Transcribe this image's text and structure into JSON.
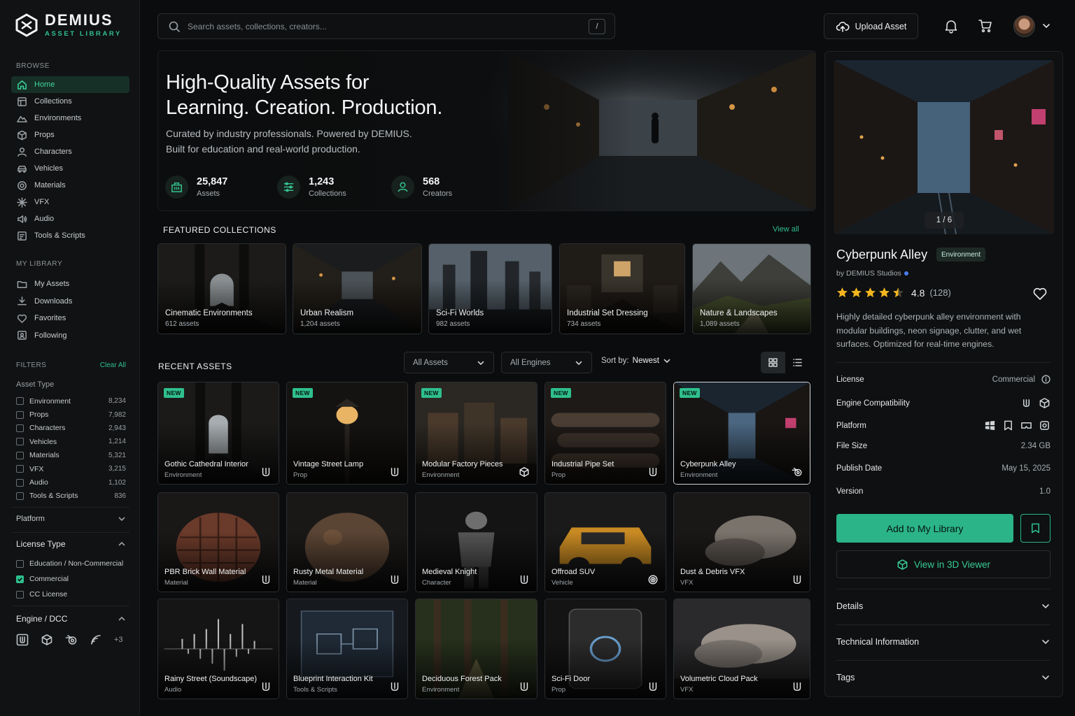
{
  "brand": {
    "name": "DEMIUS",
    "subtitle": "ASSET LIBRARY"
  },
  "sidebar": {
    "browse_heading": "BROWSE",
    "browse": [
      {
        "label": "Home",
        "icon": "home-icon",
        "active": true
      },
      {
        "label": "Collections",
        "icon": "collections-icon"
      },
      {
        "label": "Environments",
        "icon": "mountain-icon"
      },
      {
        "label": "Props",
        "icon": "cube-icon"
      },
      {
        "label": "Characters",
        "icon": "user-icon"
      },
      {
        "label": "Vehicles",
        "icon": "car-icon"
      },
      {
        "label": "Materials",
        "icon": "material-icon"
      },
      {
        "label": "VFX",
        "icon": "sparkle-icon"
      },
      {
        "label": "Audio",
        "icon": "audio-icon"
      },
      {
        "label": "Tools & Scripts",
        "icon": "tools-icon"
      }
    ],
    "library_heading": "MY LIBRARY",
    "library": [
      {
        "label": "My Assets",
        "icon": "folder-icon"
      },
      {
        "label": "Downloads",
        "icon": "download-icon"
      },
      {
        "label": "Favorites",
        "icon": "heart-icon"
      },
      {
        "label": "Following",
        "icon": "following-icon"
      }
    ],
    "filters_heading": "FILTERS",
    "clear_all": "Clear All",
    "asset_type_heading": "Asset Type",
    "asset_types": [
      {
        "label": "Environment",
        "count": "8,234"
      },
      {
        "label": "Props",
        "count": "7,982"
      },
      {
        "label": "Characters",
        "count": "2,943"
      },
      {
        "label": "Vehicles",
        "count": "1,214"
      },
      {
        "label": "Materials",
        "count": "5,321"
      },
      {
        "label": "VFX",
        "count": "3,215"
      },
      {
        "label": "Audio",
        "count": "1,102"
      },
      {
        "label": "Tools & Scripts",
        "count": "836"
      }
    ],
    "platform_heading": "Platform",
    "license_heading": "License Type",
    "licenses": [
      {
        "label": "Education / Non-Commercial",
        "checked": false
      },
      {
        "label": "Commercial",
        "checked": true
      },
      {
        "label": "CC License",
        "checked": false
      }
    ],
    "engine_heading": "Engine / DCC",
    "engine_more": "+3"
  },
  "topbar": {
    "search_placeholder": "Search assets, collections, creators...",
    "search_shortcut": "/",
    "upload_label": "Upload Asset"
  },
  "hero": {
    "title_line1": "High-Quality Assets for",
    "title_line2": "Learning. Creation. Production.",
    "subtitle_line1": "Curated by industry professionals. Powered by DEMIUS.",
    "subtitle_line2": "Built for education and real-world production.",
    "stats": [
      {
        "value": "25,847",
        "label": "Assets"
      },
      {
        "value": "1,243",
        "label": "Collections"
      },
      {
        "value": "568",
        "label": "Creators"
      }
    ]
  },
  "featured": {
    "heading": "FEATURED COLLECTIONS",
    "view_all": "View all",
    "items": [
      {
        "title": "Cinematic Environments",
        "count": "612 assets"
      },
      {
        "title": "Urban Realism",
        "count": "1,204 assets"
      },
      {
        "title": "Sci-Fi Worlds",
        "count": "982 assets"
      },
      {
        "title": "Industrial Set Dressing",
        "count": "734 assets"
      },
      {
        "title": "Nature & Landscapes",
        "count": "1,089 assets"
      }
    ]
  },
  "recent": {
    "heading": "RECENT ASSETS",
    "filter_assets": "All Assets",
    "filter_engines": "All Engines",
    "sort_label": "Sort by:",
    "sort_value": "Newest",
    "new_badge": "NEW",
    "items": [
      {
        "title": "Gothic Cathedral Interior",
        "type": "Environment",
        "new": true,
        "engine": "unreal-icon"
      },
      {
        "title": "Vintage Street Lamp",
        "type": "Prop",
        "new": true,
        "engine": "unreal-icon"
      },
      {
        "title": "Modular Factory Pieces",
        "type": "Environment",
        "new": true,
        "engine": "unity-icon"
      },
      {
        "title": "Industrial Pipe Set",
        "type": "Prop",
        "new": true,
        "engine": "unreal-icon"
      },
      {
        "title": "Cyberpunk Alley",
        "type": "Environment",
        "new": true,
        "engine": "blender-icon"
      },
      {
        "title": "PBR Brick Wall Material",
        "type": "Material",
        "engine": "unreal-icon"
      },
      {
        "title": "Rusty Metal Material",
        "type": "Material",
        "engine": "unreal-icon"
      },
      {
        "title": "Medieval Knight",
        "type": "Character",
        "engine": "unreal-icon"
      },
      {
        "title": "Offroad SUV",
        "type": "Vehicle",
        "engine": "houdini-icon"
      },
      {
        "title": "Dust & Debris VFX",
        "type": "VFX",
        "engine": "unreal-icon"
      },
      {
        "title": "Rainy Street (Soundscape)",
        "type": "Audio",
        "engine": "unreal-icon"
      },
      {
        "title": "Blueprint Interaction Kit",
        "type": "Tools & Scripts",
        "engine": "unreal-icon"
      },
      {
        "title": "Deciduous Forest Pack",
        "type": "Environment",
        "engine": "unreal-icon"
      },
      {
        "title": "Sci-Fi Door",
        "type": "Prop",
        "engine": "unreal-icon"
      },
      {
        "title": "Volumetric Cloud Pack",
        "type": "VFX",
        "engine": "unreal-icon"
      }
    ]
  },
  "detail": {
    "pager": "1 / 6",
    "title": "Cyberpunk Alley",
    "tag": "Environment",
    "by": "by DEMIUS Studios",
    "rating_value": "4.8",
    "rating_count": "(128)",
    "rating_stars": 4.5,
    "description": "Highly detailed cyberpunk alley environment with modular buildings, neon signage, clutter, and wet surfaces. Optimized for real-time engines.",
    "rows": [
      {
        "label": "License",
        "value": "Commercial"
      },
      {
        "label": "Engine Compatibility",
        "value": ""
      },
      {
        "label": "Platform",
        "value": ""
      },
      {
        "label": "File Size",
        "value": "2.34 GB"
      },
      {
        "label": "Publish Date",
        "value": "May 15, 2025"
      },
      {
        "label": "Version",
        "value": "1.0"
      }
    ],
    "add_label": "Add to My Library",
    "view3d_label": "View in 3D Viewer",
    "accordions": [
      "Details",
      "Technical Information",
      "Tags"
    ]
  },
  "colors": {
    "accent": "#2fbf8e",
    "star": "#f3b61f",
    "background": "#0b0c0d"
  }
}
